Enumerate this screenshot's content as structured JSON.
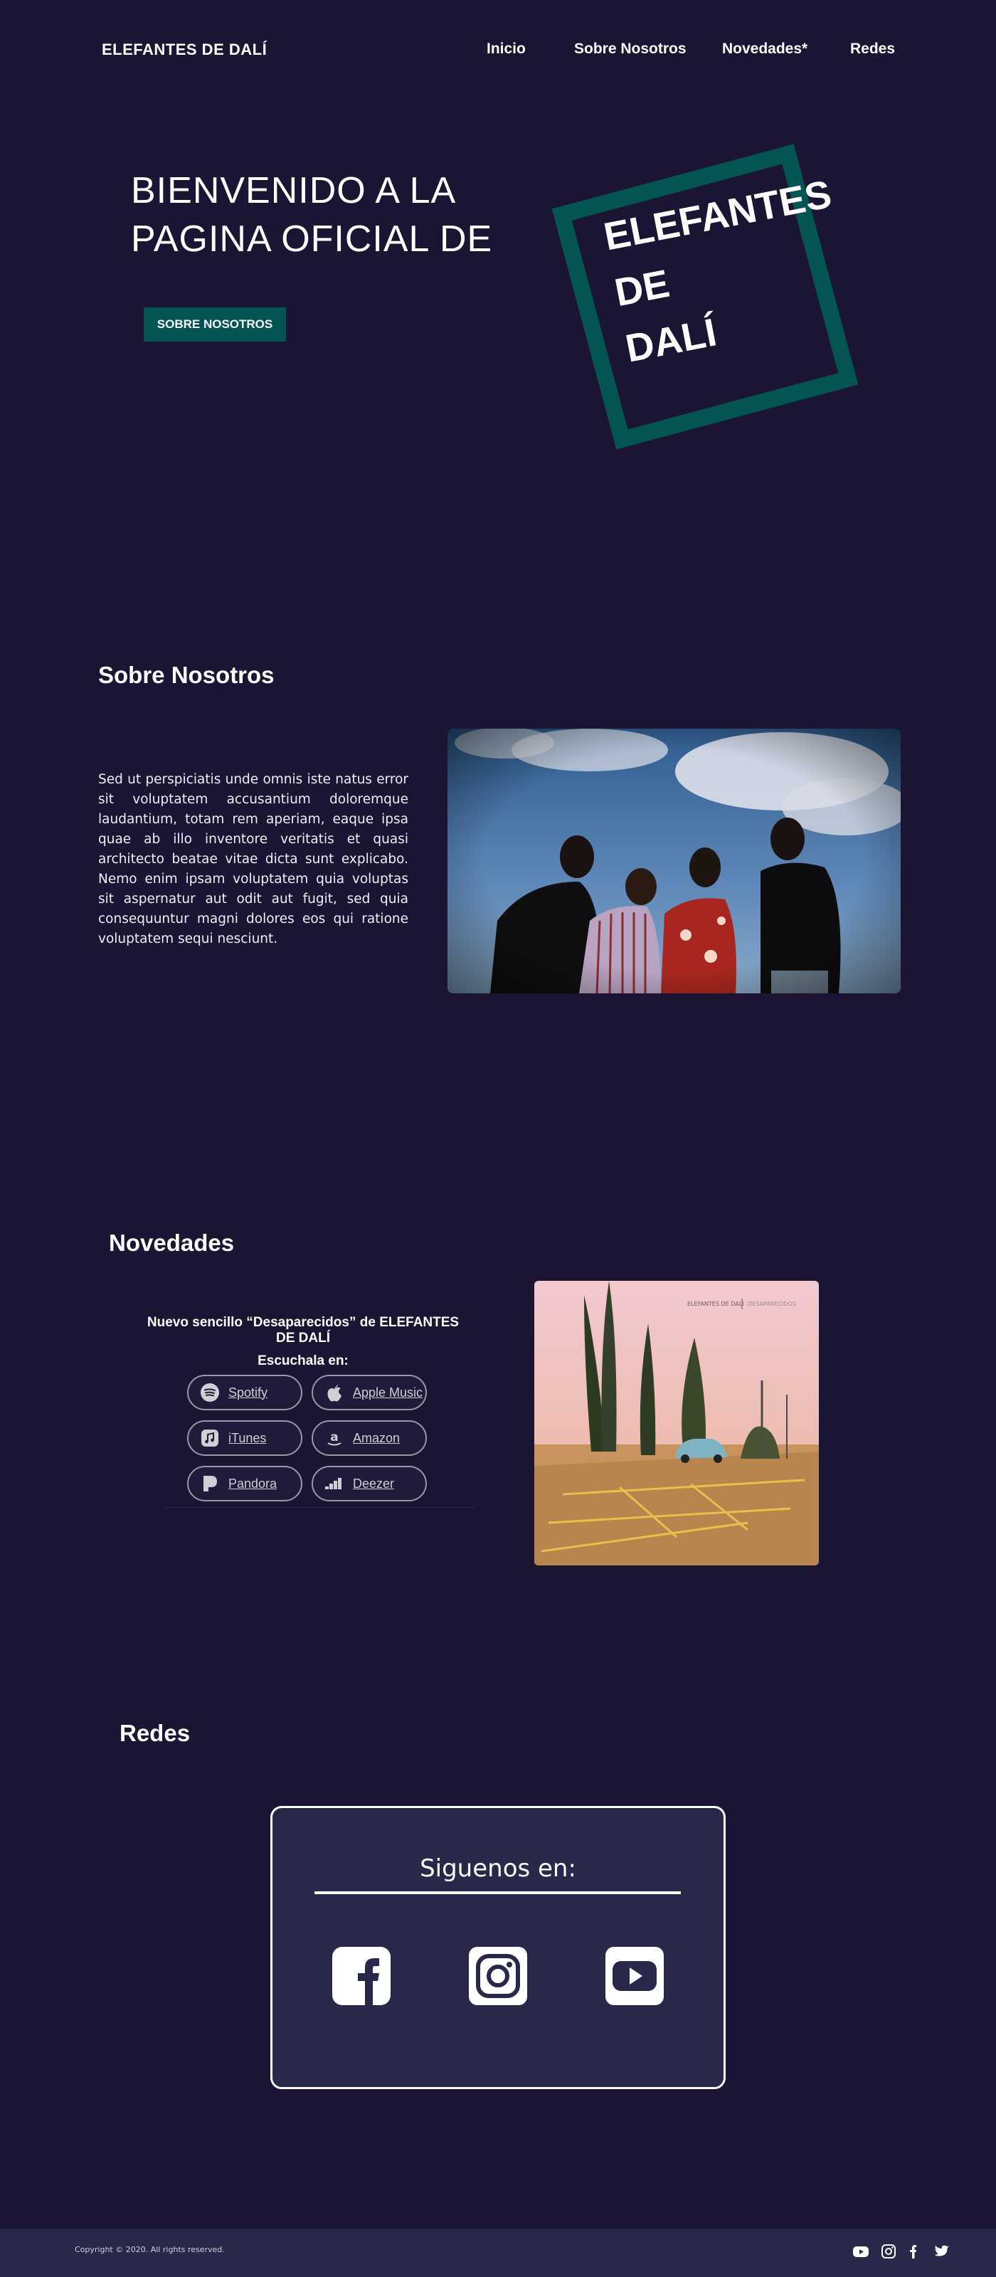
{
  "header": {
    "brand": "ELEFANTES DE DALÍ",
    "nav": [
      "Inicio",
      "Sobre Nosotros",
      "Novedades*",
      "Redes"
    ]
  },
  "hero": {
    "title": "BIENVENIDO A LA PAGINA OFICIAL DE",
    "button": "SOBRE NOSOTROS",
    "logo_lines": [
      "ELEFANTES",
      "DE",
      "DALÍ"
    ]
  },
  "about": {
    "heading": "Sobre Nosotros",
    "text": "Sed ut perspiciatis unde omnis iste natus error sit voluptatem accusantium doloremque laudantium, totam rem aperiam, eaque ipsa quae ab illo inventore veritatis et quasi architecto beatae vitae dicta sunt explicabo. Nemo enim ipsam voluptatem quia voluptas sit aspernatur aut odit aut fugit, sed quia consequuntur magni dolores eos qui ratione voluptatem sequi nesciunt.",
    "photo_icon": "band-photo"
  },
  "news": {
    "heading": "Novedades",
    "single_title": "Nuevo sencillo “Desaparecidos” de ELEFANTES DE DALÍ",
    "listen_label": "Escuchala en:",
    "platforms": [
      {
        "label": "Spotify",
        "icon": "spotify-icon"
      },
      {
        "label": "Apple Music",
        "icon": "apple-icon"
      },
      {
        "label": "iTunes",
        "icon": "itunes-icon"
      },
      {
        "label": "Amazon",
        "icon": "amazon-icon"
      },
      {
        "label": "Pandora",
        "icon": "pandora-icon"
      },
      {
        "label": "Deezer",
        "icon": "deezer-icon"
      }
    ],
    "album_artist": "ELEFANTES DE DALÍ",
    "album_title": "DESAPARECIDOS"
  },
  "social": {
    "heading": "Redes",
    "card_title": "Siguenos en:",
    "icons": [
      "facebook-icon",
      "instagram-icon",
      "youtube-icon"
    ]
  },
  "footer": {
    "copyright": "Copyright © 2020. All rights reserved.",
    "icons": [
      "youtube-icon",
      "instagram-icon",
      "facebook-icon",
      "twitter-icon"
    ]
  },
  "colors": {
    "background": "#1b1433",
    "accent_teal": "#035553",
    "card": "#28284a"
  }
}
